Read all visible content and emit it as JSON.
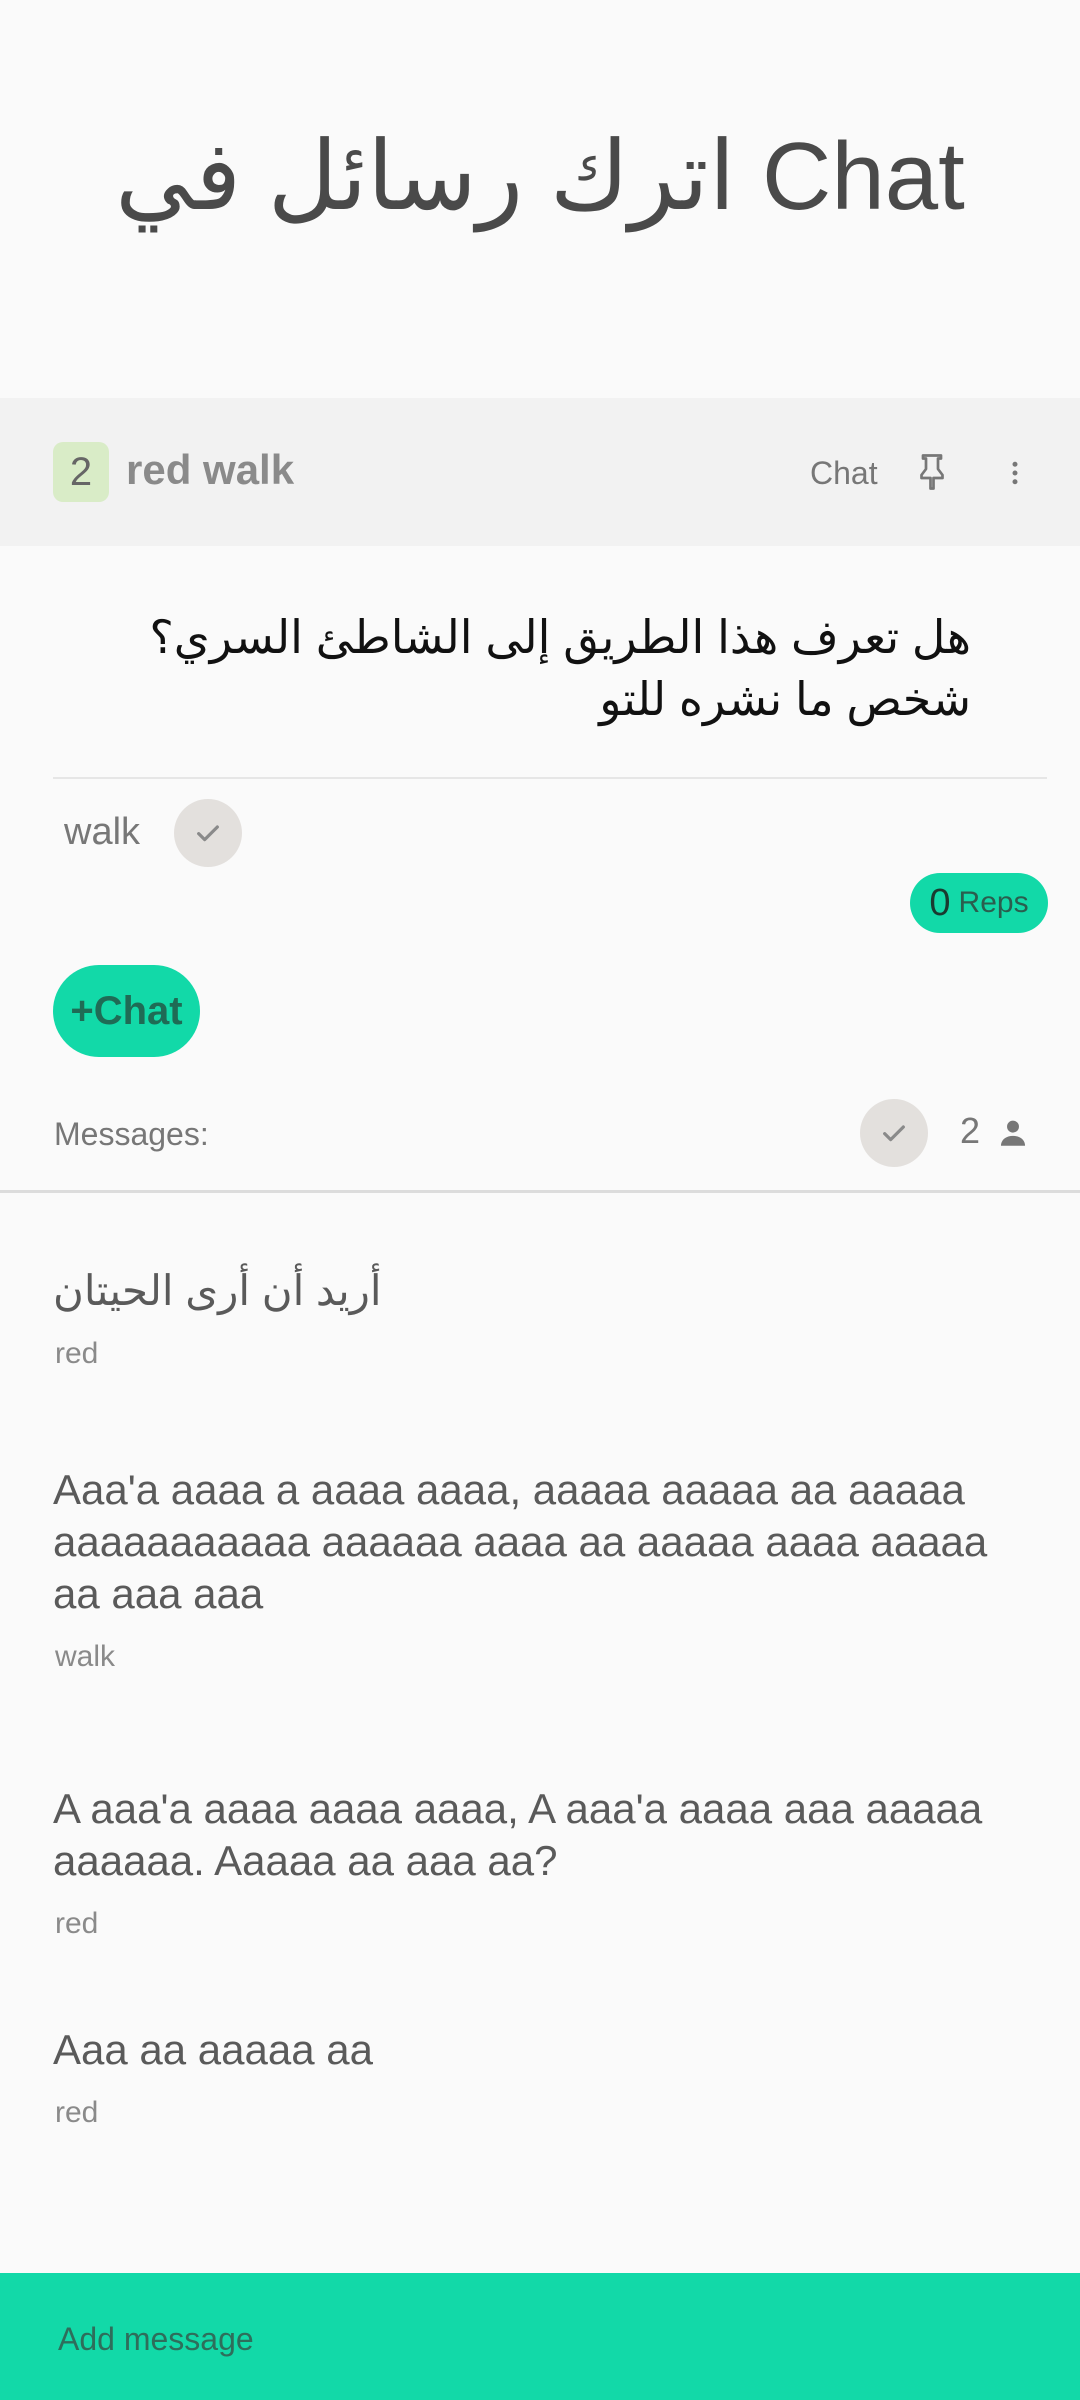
{
  "page": {
    "title": "اترك رسائل في Chat"
  },
  "post": {
    "badge_count": "2",
    "author": "red walk",
    "chat_label": "Chat",
    "text": "هل تعرف هذا الطريق إلى الشاطئ السري؟ شخص ما نشره للتو",
    "tag": "walk",
    "reps_count": "0",
    "reps_label": "Reps",
    "add_chat_label": "+Chat"
  },
  "messages_section": {
    "label": "Messages:",
    "participants_count": "2"
  },
  "messages": [
    {
      "text": "أريد أن أرى الحيتان",
      "author": "red"
    },
    {
      "text": "Aaa'a aaaa a aaaa aaaa, aaaaa aaaaa aa aaaaa aaaaaaaaaaa aaaaaa aaaa aa aaaaa aaaa aaaaa aa aaa aaa",
      "author": "walk"
    },
    {
      "text": "A aaa'a aaaa aaaa aaaa, A aaa'a aaaa aaa aaaaa aaaaaa. Aaaaa aa aaa aa?",
      "author": "red"
    },
    {
      "text": "Aaa aa aaaaa aa",
      "author": "red"
    }
  ],
  "composer": {
    "placeholder": "Add message"
  },
  "icons": {
    "pin": "pin-icon",
    "more": "more-vertical-icon",
    "check": "check-icon",
    "person": "person-icon"
  },
  "colors": {
    "accent": "#12d9a8",
    "badge_bg": "#d9ecc7",
    "check_bg": "#e3e0dd"
  }
}
